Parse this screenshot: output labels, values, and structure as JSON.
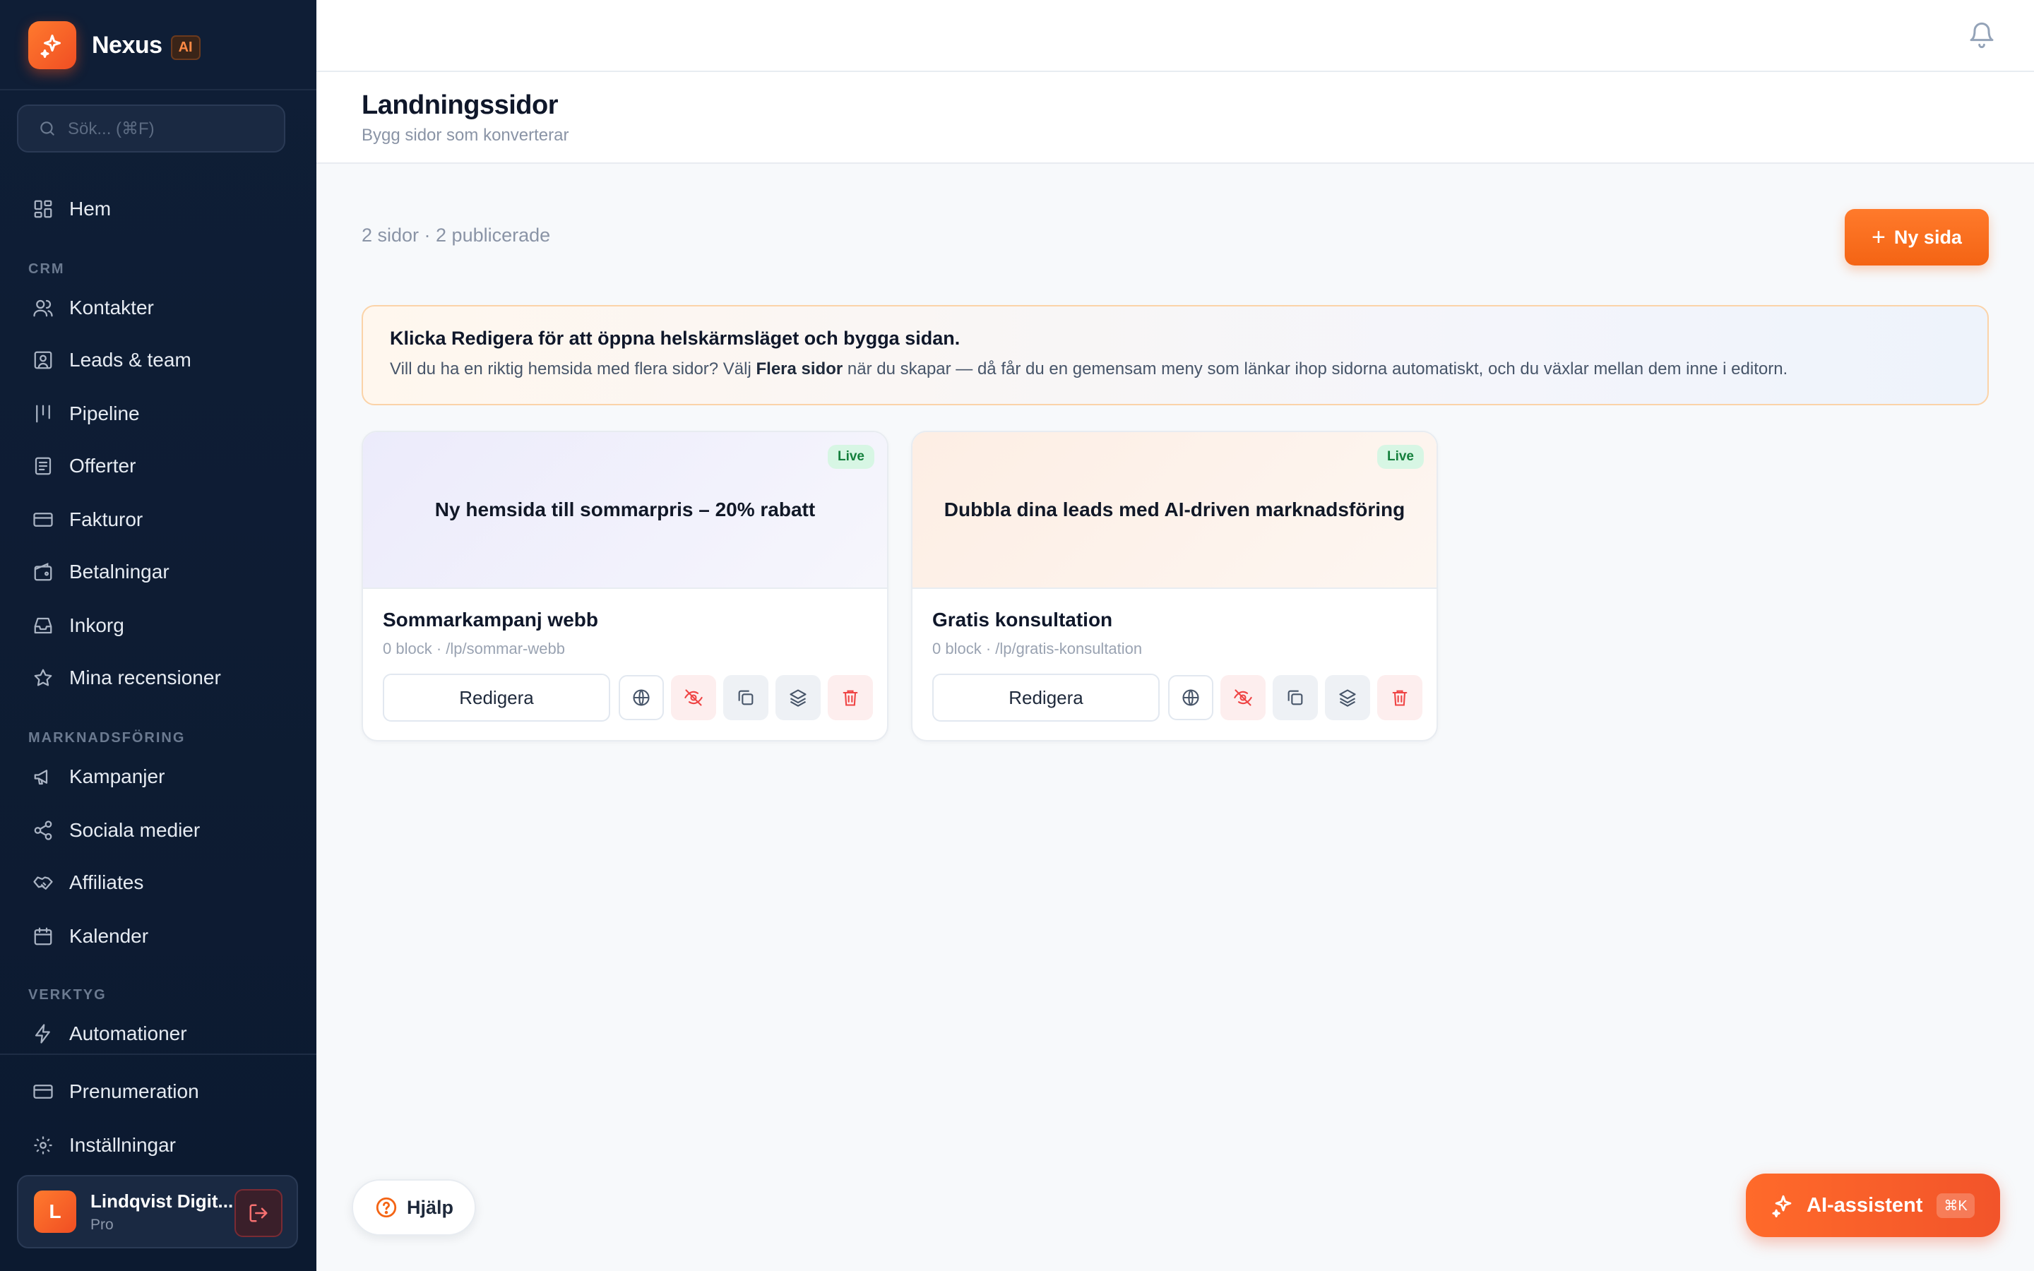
{
  "brand": {
    "name": "Nexus",
    "badge": "AI"
  },
  "search": {
    "placeholder": "Sök... (⌘F)"
  },
  "nav": {
    "home": "Hem",
    "sections": {
      "crm": "CRM",
      "marketing": "MARKNADSFÖRING",
      "tools": "VERKTYG"
    },
    "crm": [
      "Kontakter",
      "Leads & team",
      "Pipeline",
      "Offerter",
      "Fakturor",
      "Betalningar",
      "Inkorg",
      "Mina recensioner"
    ],
    "marketing": [
      "Kampanjer",
      "Sociala medier",
      "Affiliates",
      "Kalender"
    ],
    "tools": [
      "Automationer"
    ],
    "bottom": [
      "Prenumeration",
      "Inställningar"
    ]
  },
  "user": {
    "initial": "L",
    "name": "Lindqvist Digit...",
    "plan": "Pro"
  },
  "page": {
    "title": "Landningssidor",
    "subtitle": "Bygg sidor som konverterar"
  },
  "summary": "2 sidor · 2 publicerade",
  "new_button": "Ny sida",
  "info": {
    "title": "Klicka Redigera för att öppna helskärmsläget och bygga sidan.",
    "text_before": "Vill du ha en riktig hemsida med flera sidor? Välj ",
    "text_bold": "Flera sidor",
    "text_after": " när du skapar — då får du en gemensam meny som länkar ihop sidorna automatiskt, och du växlar mellan dem inne i editorn."
  },
  "cards": [
    {
      "hero_title": "Ny hemsida till sommarpris – 20% rabatt",
      "status": "Live",
      "name": "Sommarkampanj webb",
      "meta": "0 block · /lp/sommar-webb",
      "edit_label": "Redigera"
    },
    {
      "hero_title": "Dubbla dina leads med AI-driven marknadsföring",
      "status": "Live",
      "name": "Gratis konsultation",
      "meta": "0 block · /lp/gratis-konsultation",
      "edit_label": "Redigera"
    }
  ],
  "help_button": "Hjälp",
  "ai_button": {
    "label": "AI-assistent",
    "shortcut": "⌘K"
  },
  "colors": {
    "accent": "#f46414",
    "sidebar": "#0f1e36",
    "live_bg": "#d7f6e4",
    "live_text": "#15803d",
    "danger": "#ef4444"
  }
}
